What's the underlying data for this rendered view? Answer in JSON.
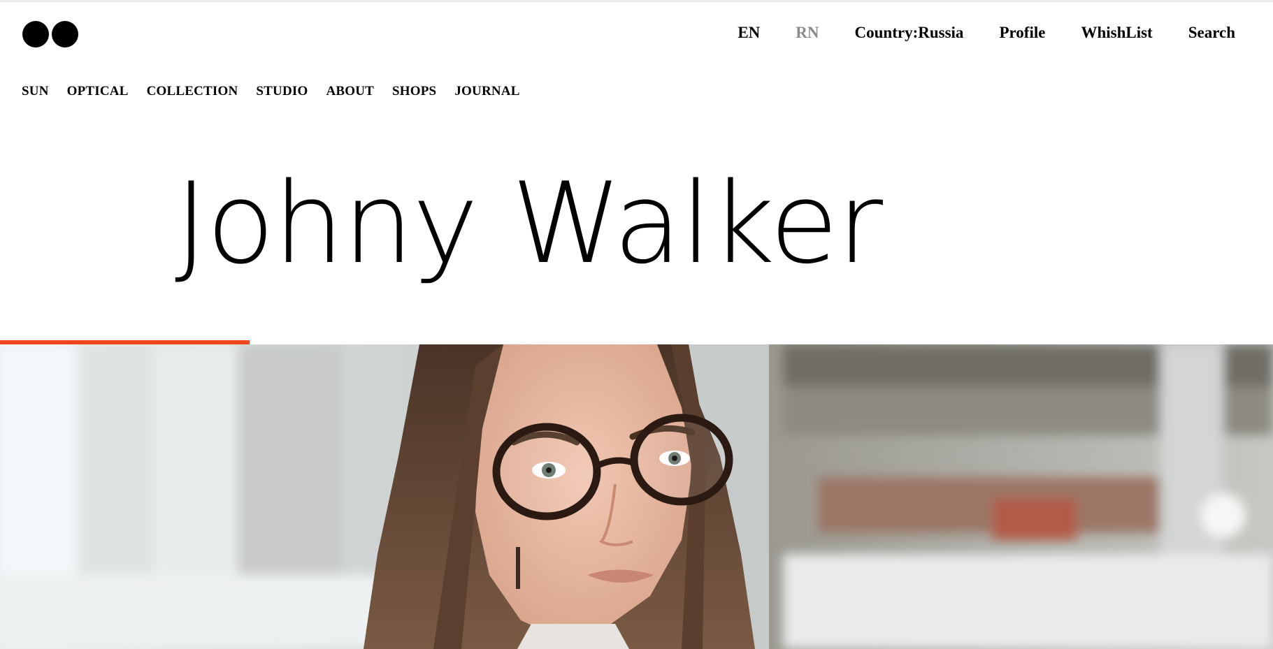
{
  "brand": {
    "logo_icon": "two-dots-logo-icon"
  },
  "utility_nav": {
    "lang_en": "EN",
    "lang_rn": "RN",
    "country": "Country:Russia",
    "profile": "Profile",
    "wishlist": "WhishList",
    "search": "Search"
  },
  "main_nav": {
    "items": [
      {
        "label": "SUN"
      },
      {
        "label": "OPTICAL"
      },
      {
        "label": "COLLECTION"
      },
      {
        "label": "STUDIO"
      },
      {
        "label": "ABOUT"
      },
      {
        "label": "SHOPS"
      },
      {
        "label": "JOURNAL"
      }
    ]
  },
  "hero": {
    "title": "Johny Walker",
    "progress_fraction": 0.196,
    "accent_color": "#f0461a"
  }
}
